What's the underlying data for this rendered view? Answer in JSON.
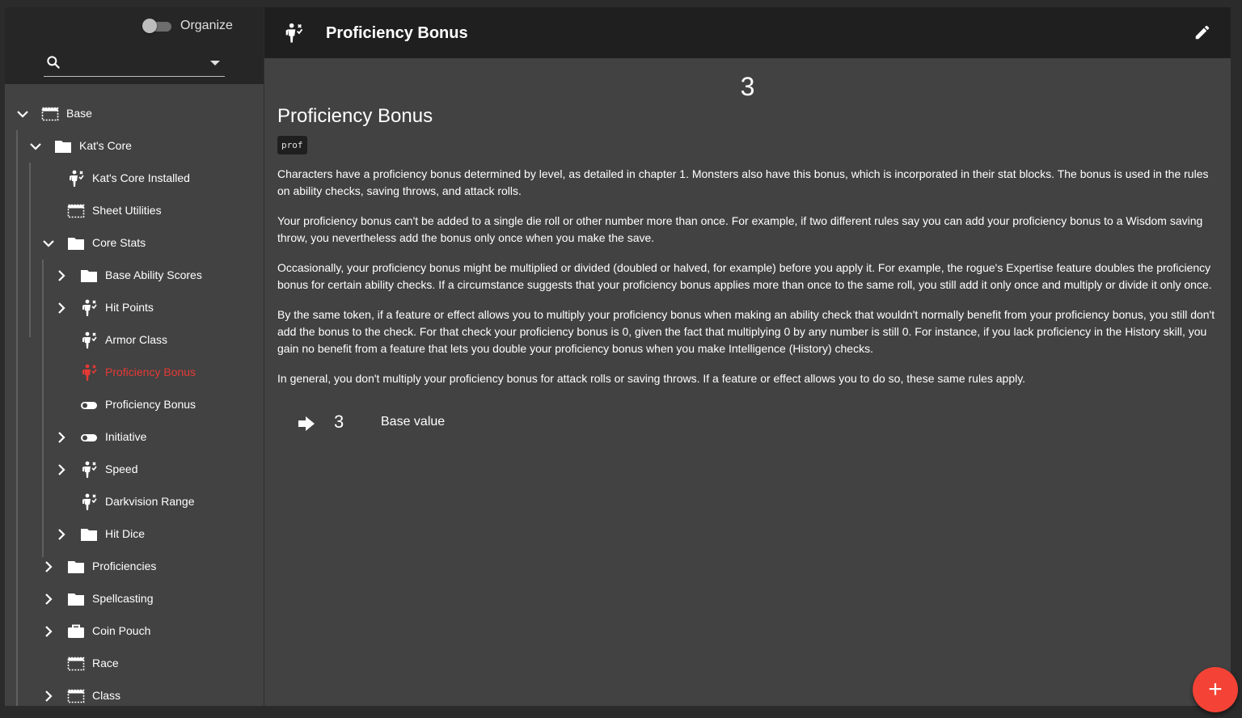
{
  "sidebar": {
    "organize_label": "Organize",
    "organize_on": false,
    "search_value": "",
    "tree": [
      {
        "label": "Base",
        "icon": "slot-icon",
        "expandable": true,
        "expanded": true,
        "active": false
      },
      {
        "label": "Kat's Core",
        "icon": "folder-icon",
        "expandable": true,
        "expanded": true,
        "active": false
      },
      {
        "label": "Kat's Core Installed",
        "icon": "attribute-icon",
        "expandable": false,
        "active": false
      },
      {
        "label": "Sheet Utilities",
        "icon": "slot-icon",
        "expandable": false,
        "active": false
      },
      {
        "label": "Core Stats",
        "icon": "folder-icon",
        "expandable": true,
        "expanded": true,
        "active": false
      },
      {
        "label": "Base Ability Scores",
        "icon": "folder-icon",
        "expandable": true,
        "expanded": false,
        "active": false
      },
      {
        "label": "Hit Points",
        "icon": "attribute-icon",
        "expandable": true,
        "expanded": false,
        "active": false
      },
      {
        "label": "Armor Class",
        "icon": "attribute-icon",
        "expandable": false,
        "active": false
      },
      {
        "label": "Proficiency Bonus",
        "icon": "attribute-icon",
        "expandable": false,
        "active": true
      },
      {
        "label": "Proficiency Bonus",
        "icon": "toggle-icon",
        "expandable": false,
        "active": false
      },
      {
        "label": "Initiative",
        "icon": "toggle-icon",
        "expandable": true,
        "expanded": false,
        "active": false
      },
      {
        "label": "Speed",
        "icon": "attribute-icon",
        "expandable": true,
        "expanded": false,
        "active": false
      },
      {
        "label": "Darkvision Range",
        "icon": "attribute-icon",
        "expandable": false,
        "active": false
      },
      {
        "label": "Hit Dice",
        "icon": "folder-icon",
        "expandable": true,
        "expanded": false,
        "active": false
      },
      {
        "label": "Proficiencies",
        "icon": "folder-icon",
        "expandable": true,
        "expanded": false,
        "active": false
      },
      {
        "label": "Spellcasting",
        "icon": "folder-icon",
        "expandable": true,
        "expanded": false,
        "active": false
      },
      {
        "label": "Coin Pouch",
        "icon": "briefcase-icon",
        "expandable": true,
        "expanded": false,
        "active": false
      },
      {
        "label": "Race",
        "icon": "slot-icon",
        "expandable": false,
        "active": false
      },
      {
        "label": "Class",
        "icon": "slot-icon",
        "expandable": true,
        "expanded": false,
        "active": false
      }
    ]
  },
  "main": {
    "title": "Proficiency Bonus",
    "value": "3",
    "heading": "Proficiency Bonus",
    "variable_name": "prof",
    "paragraphs": [
      "Characters have a proficiency bonus determined by level, as detailed in chapter 1. Monsters also have this bonus, which is incorporated in their stat blocks. The bonus is used in the rules on ability checks, saving throws, and attack rolls.",
      "Your proficiency bonus can't be added to a single die roll or other number more than once. For example, if two different rules say you can add your proficiency bonus to a Wisdom saving throw, you nevertheless add the bonus only once when you make the save.",
      "Occasionally, your proficiency bonus might be multiplied or divided (doubled or halved, for example) before you apply it. For example, the rogue's Expertise feature doubles the proficiency bonus for certain ability checks. If a circumstance suggests that your proficiency bonus applies more than once to the same roll, you still add it only once and multiply or divide it only once.",
      "By the same token, if a feature or effect allows you to multiply your proficiency bonus when making an ability check that wouldn't normally benefit from your proficiency bonus, you still don't add the bonus to the check. For that check your proficiency bonus is 0, given the fact that multiplying 0 by any number is still 0. For instance, if you lack proficiency in the History skill, you gain no benefit from a feature that lets you double your proficiency bonus when you make Intelligence (History) checks.",
      "In general, you don't multiply your proficiency bonus for attack rolls or saving throws. If a feature or effect allows you to do so, these same rules apply."
    ],
    "calculation": {
      "value": "3",
      "label": "Base value"
    }
  },
  "fab_label": "+",
  "colors": {
    "accent": "#f44336",
    "active_text": "#e53935",
    "toolbar_bg": "#1f1f1f",
    "panel_bg": "#424242"
  }
}
